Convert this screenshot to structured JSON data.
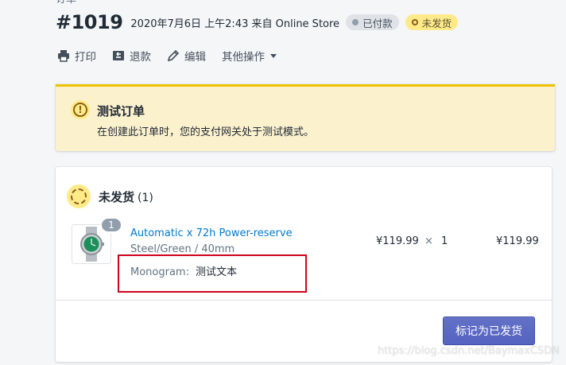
{
  "header": {
    "top_cut_text": "订单",
    "order_number": "#1019",
    "meta": "2020年7月6日 上午2:43 来自 Online Store",
    "badge_paid": "已付款",
    "badge_unfulfilled": "未发货"
  },
  "actions": {
    "print": "打印",
    "refund": "退款",
    "edit": "编辑",
    "more": "其他操作"
  },
  "banner": {
    "title": "测试订单",
    "text": "在创建此订单时，您的支付网关处于测试模式。"
  },
  "card": {
    "title": "未发货",
    "count": "(1)",
    "item": {
      "quantity_badge": "1",
      "name": "Automatic x 72h Power-reserve",
      "variant": "Steel/Green / 40mm",
      "property_key": "Monogram:",
      "property_value": "测试文本",
      "unit_price": "¥119.99",
      "times": "×",
      "quantity": "1",
      "total": "¥119.99"
    },
    "fulfill_button": "标记为已发货"
  },
  "watermark": "https://blog.csdn.net/BaymaxCSDN",
  "colors": {
    "banner_bg": "#fcf1cd",
    "banner_border": "#eec200",
    "link": "#007ace",
    "primary_button": "#5c6ac4",
    "highlight_box": "#d0021b"
  }
}
